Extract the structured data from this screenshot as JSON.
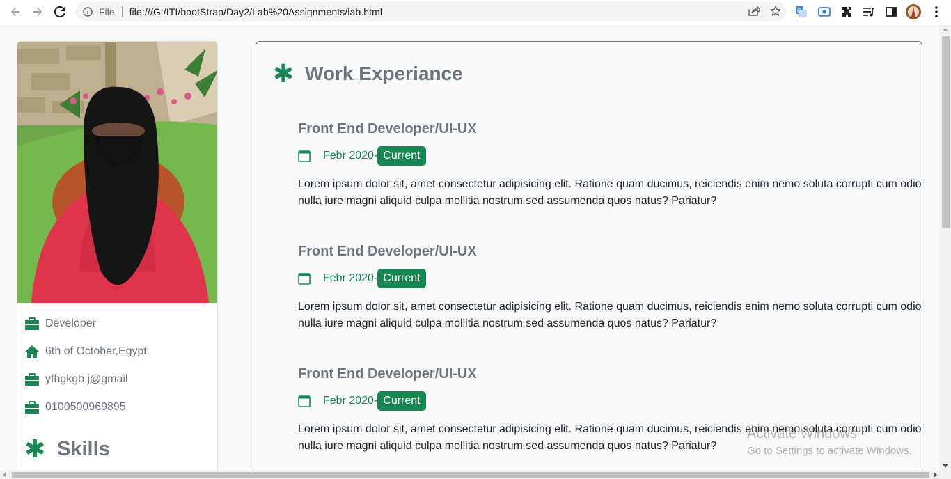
{
  "browser": {
    "scheme": "File",
    "url": "file:///G:/ITI/bootStrap/Day2/Lab%20Assignments/lab.html"
  },
  "sidebar": {
    "info": [
      {
        "icon": "briefcase-icon",
        "text": "Developer"
      },
      {
        "icon": "home-icon",
        "text": "6th of October,Egypt"
      },
      {
        "icon": "briefcase-icon",
        "text": "yfhgkgb,j@gmail"
      },
      {
        "icon": "briefcase-icon",
        "text": "0100500969895"
      }
    ],
    "skills_heading": "Skills"
  },
  "work": {
    "heading": "Work Experiance",
    "jobs": [
      {
        "title": "Front End Developer/UI-UX",
        "date": "Febr 2020-",
        "badge": "Current",
        "desc_line1": "Lorem ipsum dolor sit, amet consectetur adipisicing elit. Ratione quam ducimus, reiciendis enim nemo soluta corrupti cum odio",
        "desc_line2": "nulla iure magni aliquid culpa mollitia nostrum sed assumenda quos natus? Pariatur?"
      },
      {
        "title": "Front End Developer/UI-UX",
        "date": "Febr 2020-",
        "badge": "Current",
        "desc_line1": "Lorem ipsum dolor sit, amet consectetur adipisicing elit. Ratione quam ducimus, reiciendis enim nemo soluta corrupti cum odio",
        "desc_line2": "nulla iure magni aliquid culpa mollitia nostrum sed assumenda quos natus? Pariatur?"
      },
      {
        "title": "Front End Developer/UI-UX",
        "date": "Febr 2020-",
        "badge": "Current",
        "desc_line1": "Lorem ipsum dolor sit, amet consectetur adipisicing elit. Ratione quam ducimus, reiciendis enim nemo soluta corrupti cum odio",
        "desc_line2": "nulla iure magni aliquid culpa mollitia nostrum sed assumenda quos natus? Pariatur?"
      }
    ]
  },
  "watermark": {
    "line1": "Activate Windows",
    "line2": "Go to Settings to activate Windows."
  },
  "colors": {
    "accent": "#198754",
    "muted": "#6c757d"
  }
}
